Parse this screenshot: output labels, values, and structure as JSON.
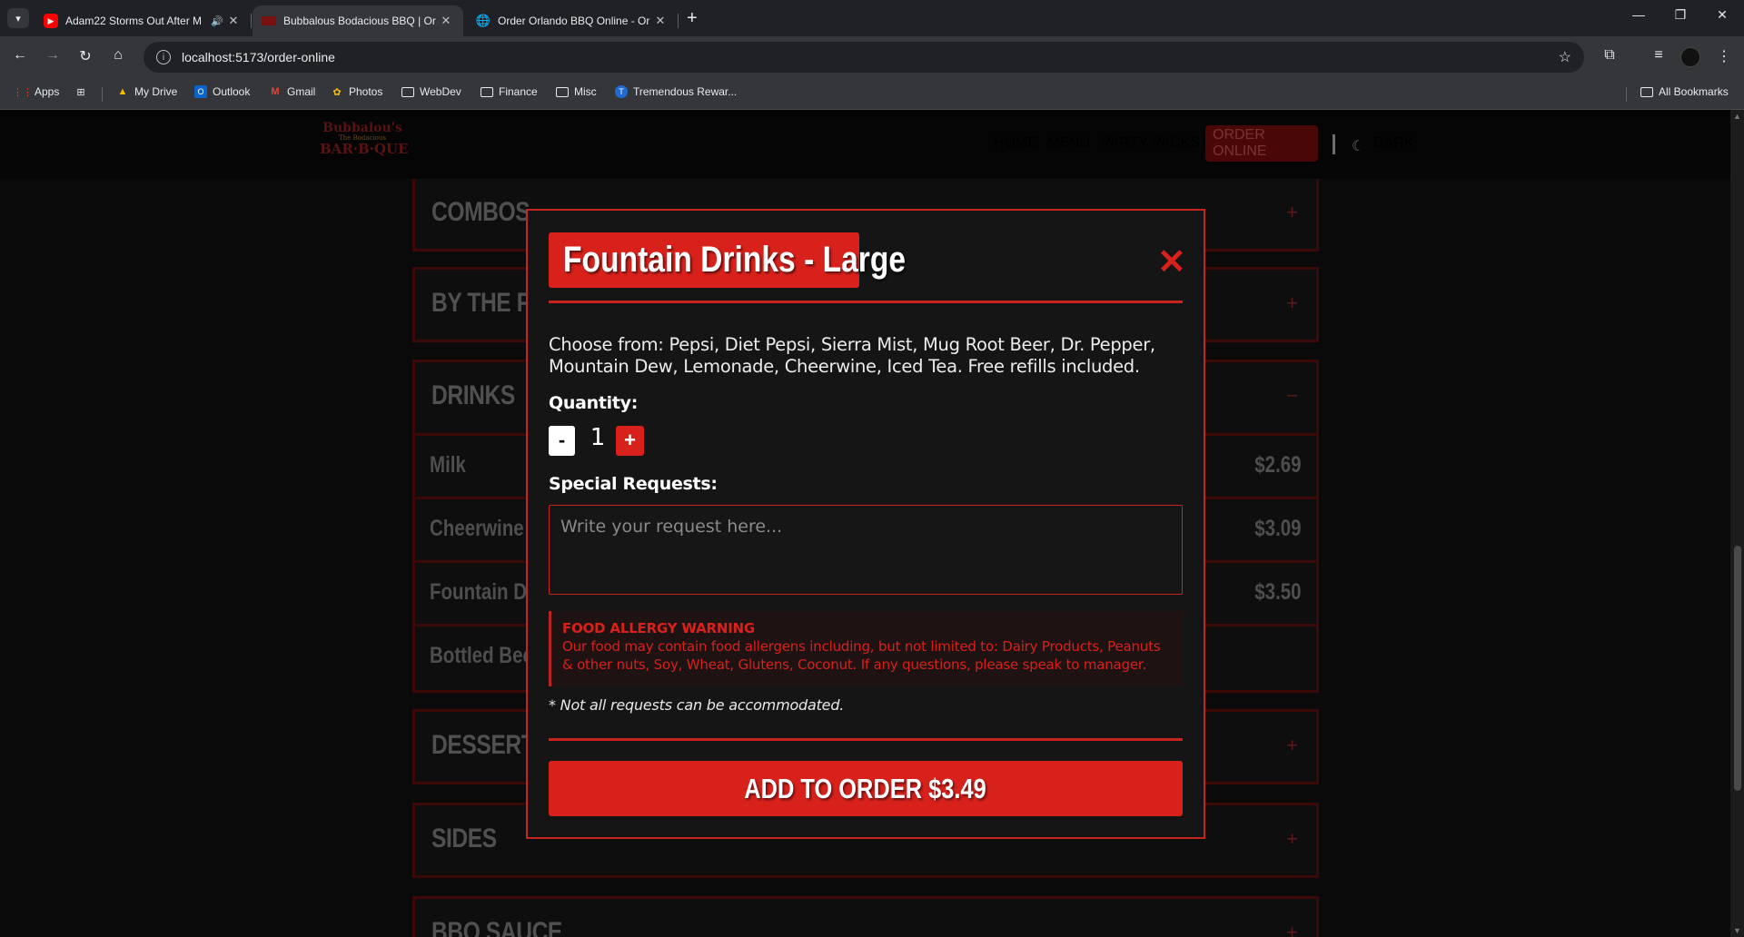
{
  "browser": {
    "tabs": [
      {
        "title": "Adam22 Storms Out After M",
        "active": false
      },
      {
        "title": "Bubbalous Bodacious BBQ | Or",
        "active": true
      },
      {
        "title": "Order Orlando BBQ Online - Or",
        "active": false
      }
    ],
    "new_tab": "+",
    "url": "localhost:5173/order-online",
    "bookmarks": [
      {
        "label": "Apps"
      },
      {
        "label": "My Drive"
      },
      {
        "label": "Outlook"
      },
      {
        "label": "Gmail"
      },
      {
        "label": "Photos"
      },
      {
        "label": "WebDev"
      },
      {
        "label": "Finance"
      },
      {
        "label": "Misc"
      },
      {
        "label": "Tremendous Rewar..."
      }
    ],
    "all_bookmarks": "All Bookmarks"
  },
  "site": {
    "logo": {
      "line1": "Bubbalou's",
      "line2": "The Bodacious",
      "line3": "BAR·B·QUE"
    },
    "nav": [
      "HOME",
      "MENU",
      "PARTY PACKS",
      "ORDER ONLINE"
    ],
    "theme_toggle": "DARK"
  },
  "menu": {
    "sections": [
      {
        "title": "COMBOS",
        "toggle": "+"
      },
      {
        "title": "BY THE P",
        "toggle": "+"
      },
      {
        "title": "DRINKS",
        "toggle": "−"
      },
      {
        "title": "DESSERTS",
        "toggle": "+"
      },
      {
        "title": "SIDES",
        "toggle": "+"
      },
      {
        "title": "BBQ SAUCE",
        "toggle": "+"
      }
    ],
    "drinks": [
      {
        "name": "Milk",
        "price": "$2.69"
      },
      {
        "name": "Cheerwine",
        "price": "$3.09"
      },
      {
        "name": "Fountain Dri",
        "price": "$3.50"
      },
      {
        "name": "Bottled Bee",
        "price": ""
      }
    ]
  },
  "modal": {
    "title": "Fountain Drinks - Large",
    "close": "✕",
    "description": "Choose from: Pepsi, Diet Pepsi, Sierra Mist, Mug Root Beer, Dr. Pepper, Mountain Dew, Lemonade, Cheerwine, Iced Tea. Free refills included.",
    "quantity_label": "Quantity:",
    "quantity_minus": "-",
    "quantity_value": "1",
    "quantity_plus": "+",
    "special_label": "Special Requests:",
    "special_placeholder": "Write your request here...",
    "allergy_heading": "FOOD ALLERGY WARNING",
    "allergy_body": "Our food may contain food allergens including, but not limited to: Dairy Products, Peanuts & other nuts, Soy, Wheat, Glutens, Coconut. If any questions, please speak to manager.",
    "note": "* Not all requests can be accommodated.",
    "add_button": "ADD TO ORDER $3.49"
  },
  "colors": {
    "accent": "#d9211c",
    "background": "#0a0a0a"
  }
}
